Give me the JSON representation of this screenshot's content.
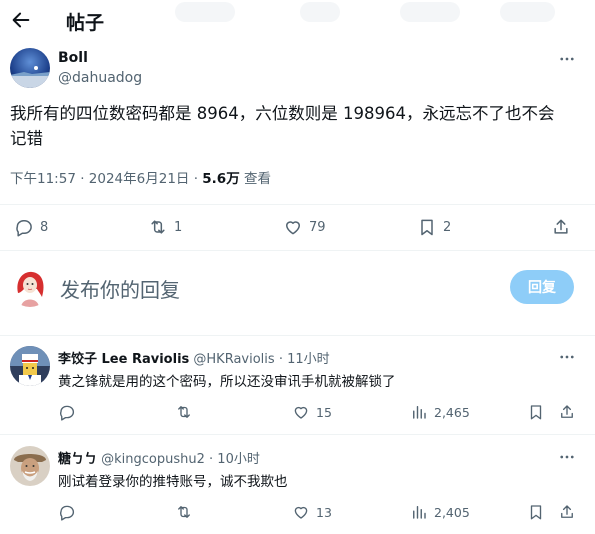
{
  "header": {
    "title": "帖子"
  },
  "post": {
    "author_name": "Boll",
    "author_handle": "@dahuadog",
    "text_line1": "我所有的四位数密码都是 8964，六位数则是 198964，永远忘不了也不会",
    "text_line2": "记错",
    "time": "下午11:57 · 2024年6月21日 · ",
    "views": "5.6万",
    "views_label": " 查看",
    "stats": {
      "replies": "8",
      "reposts": "1",
      "likes": "79",
      "bookmarks": "2"
    }
  },
  "compose": {
    "placeholder": "发布你的回复",
    "button_label": "回复"
  },
  "replies": [
    {
      "name": "李饺子 Lee Raviolis",
      "handle": "@HKRaviolis",
      "time": " · 11小时",
      "text": "黄之锋就是用的这个密码，所以还没审讯手机就被解锁了",
      "replies": "",
      "reposts": "",
      "likes": "15",
      "views": "2,465"
    },
    {
      "name": "糖ㄅㄅ",
      "handle": "@kingcopushu2",
      "time": " · 10小时",
      "text": "刚试着登录你的推特账号，诚不我欺也",
      "replies": "",
      "reposts": "",
      "likes": "13",
      "views": "2,405"
    }
  ],
  "icons": {
    "back": "arrow-left-icon",
    "more": "more-dots-icon",
    "reply": "reply-bubble-icon",
    "repost": "repost-icon",
    "like": "heart-icon",
    "bookmark": "bookmark-icon",
    "share": "share-icon",
    "views": "bar-chart-icon"
  },
  "colors": {
    "accent": "#1d9bf0",
    "accent_disabled": "#8ecdf8",
    "secondary_text": "#536471"
  }
}
